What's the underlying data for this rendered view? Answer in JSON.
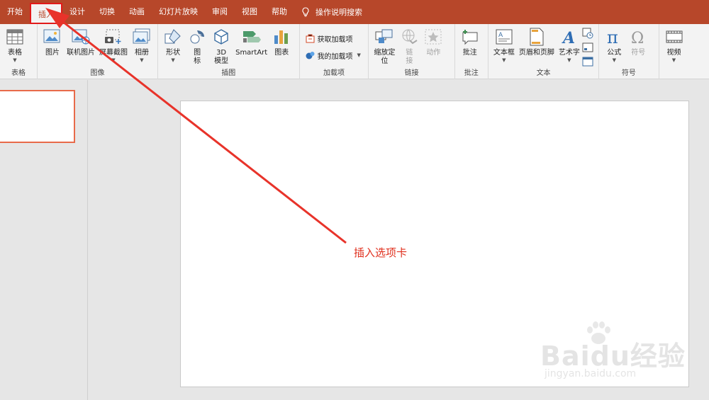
{
  "tabs": [
    {
      "label": "开始",
      "active": false
    },
    {
      "label": "插入",
      "active": true
    },
    {
      "label": "设计",
      "active": false
    },
    {
      "label": "切换",
      "active": false
    },
    {
      "label": "动画",
      "active": false
    },
    {
      "label": "幻灯片放映",
      "active": false
    },
    {
      "label": "审阅",
      "active": false
    },
    {
      "label": "视图",
      "active": false
    },
    {
      "label": "帮助",
      "active": false
    }
  ],
  "tell_me": {
    "label": "操作说明搜索",
    "icon": "lightbulb-icon"
  },
  "ribbon": {
    "tables": {
      "group_label": "表格",
      "table_label": "表格"
    },
    "images": {
      "group_label": "图像",
      "pictures": "图片",
      "online_pictures": "联机图片",
      "screenshot": "屏幕截图",
      "album": "相册"
    },
    "illustrations": {
      "group_label": "插图",
      "shapes": "形状",
      "icons_line1": "图",
      "icons_line2": "标",
      "model_line1": "3D",
      "model_line2": "模型",
      "smartart": "SmartArt",
      "chart": "图表"
    },
    "addins": {
      "group_label": "加载项",
      "get_addins": "获取加载项",
      "my_addins": "我的加载项"
    },
    "links": {
      "group_label": "链接",
      "zoom_line1": "缩放定",
      "zoom_line2": "位",
      "link_line1": "链",
      "link_line2": "接",
      "action": "动作"
    },
    "comments": {
      "group_label": "批注",
      "comment": "批注"
    },
    "text": {
      "group_label": "文本",
      "textbox": "文本框",
      "header_footer": "页眉和页脚",
      "wordart": "艺术字"
    },
    "symbols": {
      "group_label": "符号",
      "equation": "公式",
      "symbol": "符号"
    },
    "media": {
      "video": "视频"
    }
  },
  "annotation": {
    "text": "插入选项卡"
  },
  "watermark": {
    "brand": "Baidu经验",
    "url": "jingyan.baidu.com"
  },
  "colors": {
    "accent": "#b7472a",
    "arrow": "#e8332a",
    "highlight_box": "#e21a1a",
    "thumb_border": "#e86a4a"
  }
}
